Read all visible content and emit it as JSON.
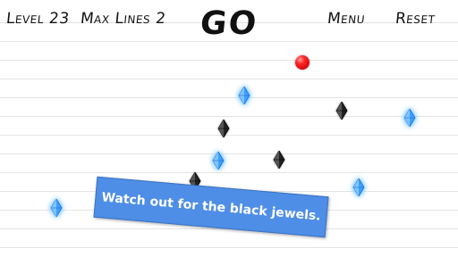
{
  "hud": {
    "level_text": "Level 23",
    "max_lines_text": "Max Lines 2",
    "go_label": "GO",
    "menu_label": "Menu",
    "reset_label": "Reset"
  },
  "tip": {
    "message": "Watch out for the black jewels."
  },
  "colors": {
    "ball": "#ff2020",
    "blue_jewel": "#3fa0ff",
    "black_jewel": "#222222",
    "banner": "#4e8ee6"
  },
  "pieces": {
    "ball_icon": "red-ball-icon",
    "blue_jewel_icon": "blue-jewel-icon",
    "black_jewel_icon": "black-jewel-icon",
    "blue_jewel_count": 6,
    "black_jewel_count": 4
  }
}
